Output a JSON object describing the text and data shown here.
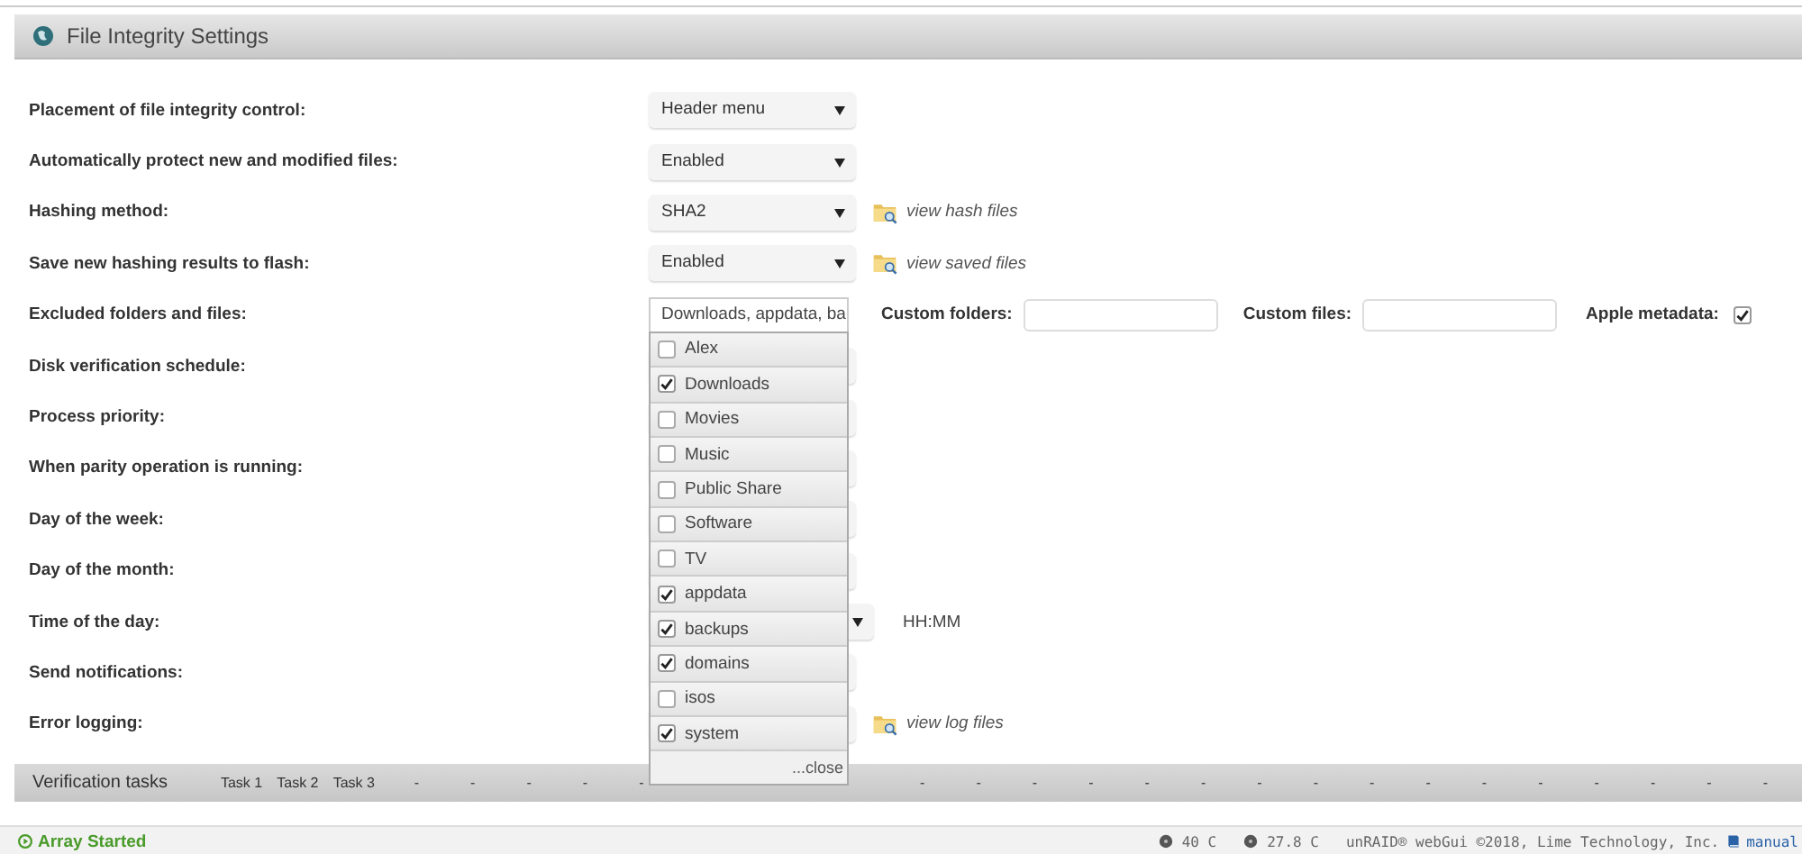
{
  "panel": {
    "title": "File Integrity Settings"
  },
  "settings": [
    {
      "label": "Placement of file integrity control:",
      "kind": "select",
      "value": "Header menu"
    },
    {
      "label": "Automatically protect new and modified files:",
      "kind": "select",
      "value": "Enabled"
    },
    {
      "label": "Hashing method:",
      "kind": "select",
      "value": "SHA2",
      "link": "view hash files"
    },
    {
      "label": "Save new hashing results to flash:",
      "kind": "select",
      "value": "Enabled",
      "link": "view saved files"
    },
    {
      "label": "Excluded folders and files:",
      "kind": "exclude"
    },
    {
      "label": "Disk verification schedule:",
      "kind": "select"
    },
    {
      "label": "Process priority:",
      "kind": "select"
    },
    {
      "label": "When parity operation is running:",
      "kind": "select"
    },
    {
      "label": "Day of the week:",
      "kind": "select"
    },
    {
      "label": "Day of the month:",
      "kind": "select"
    },
    {
      "label": "Time of the day:",
      "kind": "time",
      "suffix": "HH:MM"
    },
    {
      "label": "Send notifications:",
      "kind": "select"
    },
    {
      "label": "Error logging:",
      "kind": "select",
      "link": "view log files"
    }
  ],
  "exclude": {
    "value": "Downloads, appdata, ba",
    "custom_folders_label": "Custom folders:",
    "custom_files_label": "Custom files:",
    "apple_label": "Apple metadata:",
    "apple_checked": true,
    "options": [
      {
        "label": "Alex",
        "checked": false
      },
      {
        "label": "Downloads",
        "checked": true
      },
      {
        "label": "Movies",
        "checked": false
      },
      {
        "label": "Music",
        "checked": false
      },
      {
        "label": "Public Share",
        "checked": false
      },
      {
        "label": "Software",
        "checked": false
      },
      {
        "label": "TV",
        "checked": false
      },
      {
        "label": "appdata",
        "checked": true
      },
      {
        "label": "backups",
        "checked": true
      },
      {
        "label": "domains",
        "checked": true
      },
      {
        "label": "isos",
        "checked": false
      },
      {
        "label": "system",
        "checked": true
      }
    ],
    "close": "...close"
  },
  "verification": {
    "title": "Verification tasks",
    "tasks": [
      "Task 1",
      "Task 2",
      "Task 3"
    ],
    "columns_left": [
      "-",
      "-",
      "-",
      "-",
      "-"
    ],
    "columns_right": [
      "-",
      "-",
      "-",
      "-",
      "-",
      "-",
      "-",
      "-",
      "-",
      "-",
      "-",
      "-",
      "-",
      "-",
      "-",
      "-"
    ]
  },
  "status_bar": {
    "array_status": "Array Started",
    "temps": [
      "40 C",
      "27.8 C"
    ],
    "copyright": "unRAID® webGui ©2018, Lime Technology, Inc.",
    "manual": "manual"
  }
}
